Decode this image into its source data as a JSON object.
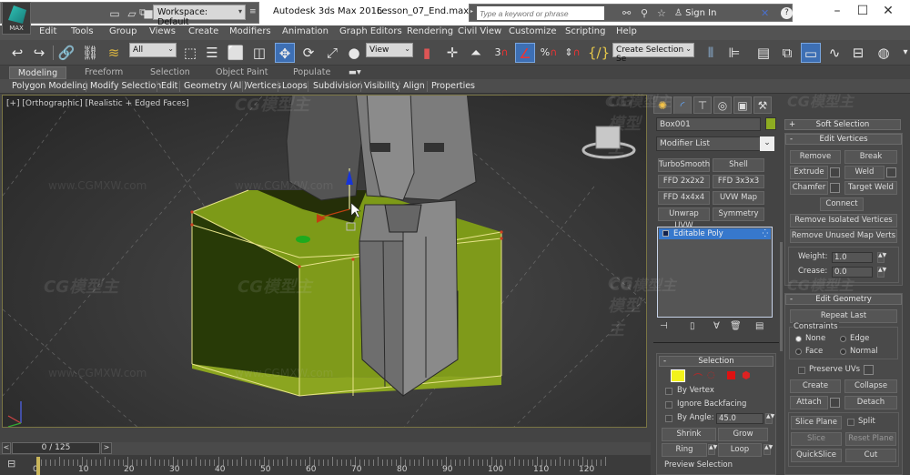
{
  "app": {
    "title": "Autodesk 3ds Max 2016",
    "file": "Lesson_07_End.max",
    "logo_label": "MAX",
    "workspace": "Workspace: Default",
    "search_placeholder": "Type a keyword or phrase",
    "sign_in": "Sign In"
  },
  "menu": [
    "Edit",
    "Tools",
    "Group",
    "Views",
    "Create",
    "Modifiers",
    "Animation",
    "Graph Editors",
    "Rendering",
    "Civil View",
    "Customize",
    "Scripting",
    "Help"
  ],
  "toolbar": {
    "selection_filter": "All",
    "ref_coord": "View",
    "named_selection": "Create Selection Se",
    "snap_angle_label": "3"
  },
  "ribbon": {
    "tabs": [
      "Modeling",
      "Freeform",
      "Selection",
      "Object Paint",
      "Populate"
    ],
    "active_tab": "Modeling",
    "panels": [
      "Polygon Modeling",
      "Modify Selection",
      "Edit",
      "Geometry (All)",
      "Vertices",
      "Loops",
      "Subdivision",
      "Visibility",
      "Align",
      "Properties"
    ]
  },
  "viewport": {
    "label": "[+] [Orthographic] [Realistic + Edged Faces]"
  },
  "watermark": {
    "logo": "CG模型主",
    "url": "www.CGMXW.com"
  },
  "timeline": {
    "frame_display": "0 / 125",
    "prev": "<",
    "next": ">",
    "current_frame": 0,
    "total_frames": 125,
    "tick_labels": [
      "0",
      "10",
      "20",
      "30",
      "40",
      "50",
      "60",
      "70",
      "80",
      "90",
      "100",
      "110",
      "120"
    ]
  },
  "command_panel": {
    "object_name": "Box001",
    "object_color": "#8eac21",
    "modifier_list": "Modifier List",
    "modifier_buttons": [
      "TurboSmooth",
      "Shell",
      "FFD 2x2x2",
      "FFD 3x3x3",
      "FFD 4x4x4",
      "UVW Map",
      "Unwrap UVW",
      "Symmetry"
    ],
    "stack": [
      "Editable Poly"
    ],
    "selection": {
      "title": "Selection",
      "by_vertex": "By Vertex",
      "ignore_backfacing": "Ignore Backfacing",
      "by_angle": "By Angle:",
      "angle_value": "45.0",
      "shrink": "Shrink",
      "grow": "Grow",
      "ring": "Ring",
      "loop": "Loop",
      "preview": "Preview Selection"
    },
    "soft_selection": "Soft Selection",
    "edit_vertices": {
      "title": "Edit Vertices",
      "remove": "Remove",
      "break": "Break",
      "extrude": "Extrude",
      "weld": "Weld",
      "chamfer": "Chamfer",
      "target_weld": "Target Weld",
      "connect": "Connect",
      "remove_isolated": "Remove Isolated Vertices",
      "remove_unused": "Remove Unused Map Verts",
      "weight_label": "Weight:",
      "weight": "1.0",
      "crease_label": "Crease:",
      "crease": "0.0"
    },
    "edit_geometry": {
      "title": "Edit Geometry",
      "repeat_last": "Repeat Last",
      "constraints": "Constraints",
      "none": "None",
      "edge": "Edge",
      "face": "Face",
      "normal": "Normal",
      "constraint_selected": "None",
      "preserve_uvs": "Preserve UVs",
      "create": "Create",
      "collapse": "Collapse",
      "attach": "Attach",
      "detach": "Detach",
      "slice_plane": "Slice Plane",
      "split": "Split",
      "slice": "Slice",
      "reset_plane": "Reset Plane",
      "quickslice": "QuickSlice",
      "cut": "Cut"
    }
  },
  "colors": {
    "accent_blue": "#3d6fb4",
    "object_green": "#8eac21",
    "vertex_yellow": "#f2f21a",
    "viewport_border": "#7a7544"
  }
}
